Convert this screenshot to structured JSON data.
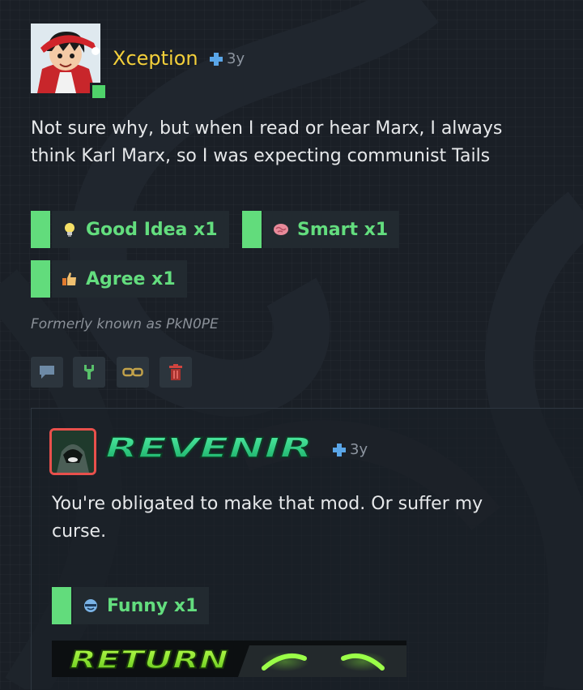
{
  "post": {
    "author": "Xception",
    "time": "3y",
    "body_line1": "Not sure why, but when I read or hear Marx, I always",
    "body_line2": "think Karl Marx, so I was expecting communist Tails",
    "reactions": [
      {
        "label": "Good Idea x1",
        "icon": "lightbulb-icon"
      },
      {
        "label": "Smart x1",
        "icon": "brain-icon"
      },
      {
        "label": "Agree x1",
        "icon": "thumbs-up-icon"
      }
    ],
    "signature": "Formerly known as PkN0PE",
    "actions": [
      {
        "icon": "comment-icon"
      },
      {
        "icon": "wrench-icon"
      },
      {
        "icon": "link-icon"
      },
      {
        "icon": "trash-icon"
      }
    ]
  },
  "reply": {
    "author": "REVENIR",
    "time": "3y",
    "body_line1": "You're obligated to make that mod. Or suffer my",
    "body_line2": "curse.",
    "reactions": [
      {
        "label": "Funny x1",
        "icon": "smile-icon"
      }
    ],
    "signature_banner": "RETURN"
  },
  "colors": {
    "background": "#1a1f26",
    "author_gold": "#f3cf3a",
    "reaction_green": "#63dd7e",
    "reaction_bg": "#222a30",
    "revenir_green": "#22c77a"
  }
}
